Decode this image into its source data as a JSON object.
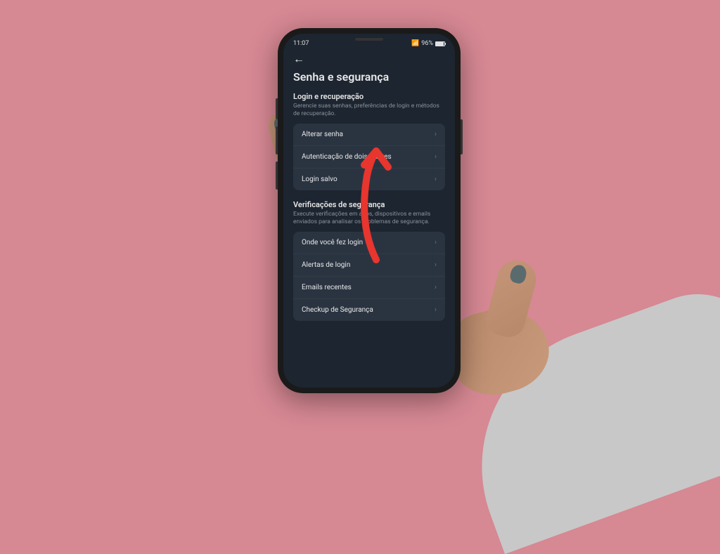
{
  "status": {
    "time": "11:07",
    "battery_pct": "96%"
  },
  "page": {
    "title": "Senha e segurança"
  },
  "sections": {
    "login": {
      "title": "Login e recuperação",
      "desc": "Gerencie suas senhas, preferências de login e métodos de recuperação.",
      "items": [
        {
          "label": "Alterar senha"
        },
        {
          "label": "Autenticação de dois fatores"
        },
        {
          "label": "Login salvo"
        }
      ]
    },
    "security": {
      "title": "Verificações de segurança",
      "desc": "Execute verificações em apps, dispositivos e emails enviados para analisar os problemas de segurança.",
      "items": [
        {
          "label": "Onde você fez login"
        },
        {
          "label": "Alertas de login"
        },
        {
          "label": "Emails recentes"
        },
        {
          "label": "Checkup de Segurança"
        }
      ]
    }
  },
  "annotation": {
    "color": "#e8352e"
  }
}
